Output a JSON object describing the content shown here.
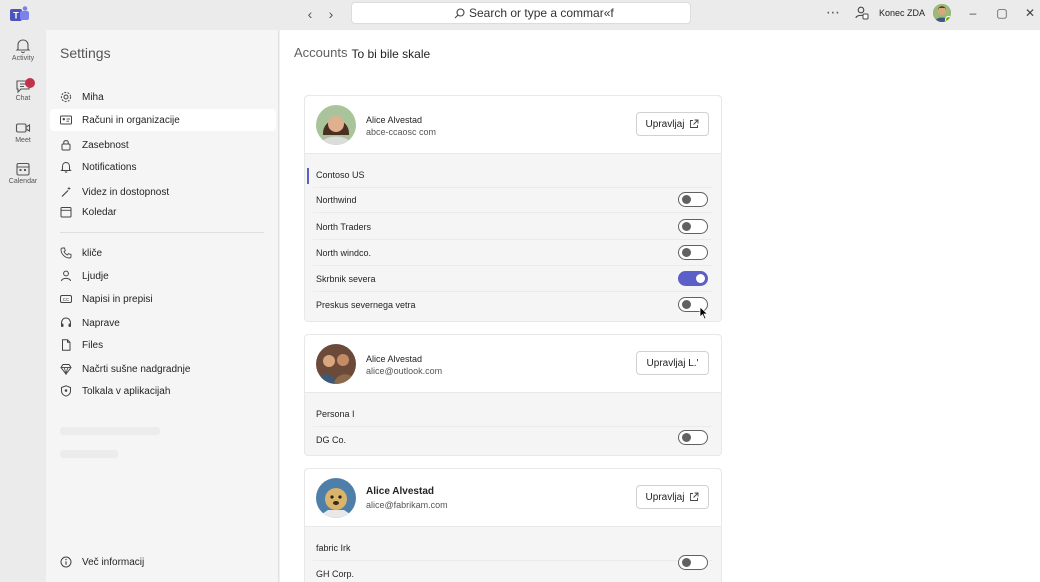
{
  "titlebar": {
    "search_placeholder": "Search or type a commar«f",
    "org_name": "Konec ZDA"
  },
  "rail": {
    "items": [
      {
        "label": "Activity",
        "icon": "bell-icon"
      },
      {
        "label": "Chat",
        "icon": "chat-icon"
      },
      {
        "label": "Meet",
        "icon": "video-icon"
      },
      {
        "label": "Calendar",
        "icon": "calendar-icon"
      }
    ]
  },
  "settings": {
    "title": "Settings",
    "menu": [
      {
        "label": "Miha",
        "icon": "gear-icon"
      },
      {
        "label": "Računi in organizacije",
        "icon": "id-card-icon"
      },
      {
        "label": "Zasebnost",
        "icon": "lock-icon"
      },
      {
        "label": "Notifications",
        "icon": "bell-icon"
      },
      {
        "label": "Videz in dostopnost",
        "icon": "wand-icon"
      },
      {
        "label": "Koledar",
        "icon": "calendar-icon"
      },
      {
        "label": "kliče",
        "icon": "phone-icon"
      },
      {
        "label": "Ljudje",
        "icon": "person-icon"
      },
      {
        "label": "Napisi in prepisi",
        "icon": "captions-icon"
      },
      {
        "label": "Naprave",
        "icon": "headset-icon"
      },
      {
        "label": "Files",
        "icon": "file-icon"
      },
      {
        "label": "Načrti sušne nadgradnje",
        "icon": "diamond-icon"
      },
      {
        "label": "Tolkala v aplikacijah",
        "icon": "shield-icon"
      }
    ],
    "footer": {
      "label": "Več informacij",
      "icon": "info-icon"
    }
  },
  "main": {
    "breadcrumb_root": "Accounts",
    "breadcrumb_sub": "To bi bile skale",
    "accounts": [
      {
        "name": "Alice Alvestad",
        "email": "abce-ccaosc com",
        "manage_label": "Upravljaj",
        "orgs": [
          {
            "label": "Contoso US",
            "selected": true,
            "toggle": null
          },
          {
            "label": "Northwind",
            "toggle": false
          },
          {
            "label": "North Traders",
            "toggle": false
          },
          {
            "label": "North windco.",
            "toggle": false
          },
          {
            "label": "Skrbnik severa",
            "toggle": true
          },
          {
            "label": "Preskus severnega vetra",
            "toggle": false
          }
        ]
      },
      {
        "name": "Alice Alvestad",
        "email": "alice@outlook.com",
        "manage_label": "Upravljaj L.'",
        "orgs": [
          {
            "label": "Persona I",
            "toggle": null
          },
          {
            "label": "DG Co.",
            "toggle": false
          }
        ]
      },
      {
        "name": "Alice Alvestad",
        "email": "alice@fabrikam.com",
        "manage_label": "Upravljaj",
        "orgs": [
          {
            "label": "fabric Irk",
            "toggle": null
          },
          {
            "label": "GH Corp.",
            "toggle": false
          }
        ]
      }
    ]
  },
  "colors": {
    "accent": "#5b5fc7",
    "badge": "#c4314b",
    "presence": "#6bb700"
  }
}
